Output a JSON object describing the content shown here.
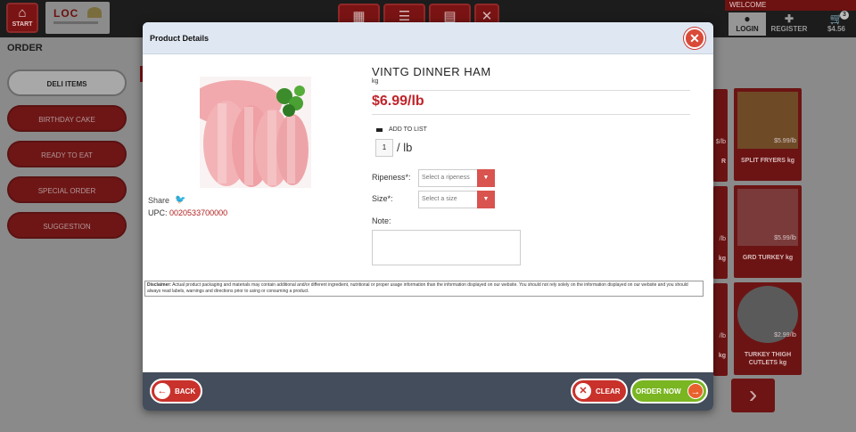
{
  "app": {
    "start_label": "START",
    "logo_text": "LOC",
    "welcome": "WELCOME",
    "login": "LOGIN",
    "register": "REGISTER",
    "cart_total": "$4.56",
    "cart_count": "3",
    "nav_icons": [
      "grid-view-icon",
      "list-view-icon",
      "flyer-icon",
      "recipes-icon"
    ]
  },
  "order": {
    "title": "ORDER",
    "categories": [
      {
        "label": "DELI ITEMS",
        "selected": true
      },
      {
        "label": "BIRTHDAY CAKE",
        "selected": false
      },
      {
        "label": "READY TO EAT",
        "selected": false
      },
      {
        "label": "SPECIAL ORDER",
        "selected": false
      },
      {
        "label": "SUGGESTION",
        "selected": false
      }
    ],
    "products": [
      {
        "name": "SPLIT FRYERS kg",
        "price": "$5.99/lb"
      },
      {
        "name": "GRD TURKEY kg",
        "price": "$5.99/lb"
      },
      {
        "name": "TURKEY THIGH CUTLETS kg",
        "price": "$2.99/lb"
      }
    ],
    "partial_cards": [
      {
        "name": "R",
        "price": "$/lb"
      },
      {
        "name": "kg",
        "price": "/lb"
      },
      {
        "name": "kg",
        "price": "/lb"
      }
    ]
  },
  "modal": {
    "title": "Product Details",
    "product_name": "VINTG DINNER HAM",
    "unit": "kg",
    "price": "$6.99/lb",
    "add_to_list": "ADD TO LIST",
    "quantity": "1",
    "quantity_unit": "/ lb",
    "share_label": "Share",
    "upc_label": "UPC:",
    "upc": "0020533700000",
    "ripeness_label": "Ripeness*:",
    "ripeness_placeholder": "Select a ripeness",
    "size_label": "Size*:",
    "size_placeholder": "Select a size",
    "note_label": "Note:",
    "disclaimer_title": "Disclaimer:",
    "disclaimer_text": "Actual product packaging and materials may contain additional and/or different ingredient, nutritional or proper usage information than the information displayed on our website. You should not rely solely on the information displayed on our website and you should always read labels, warnings and directions prior to using or consuming a product.",
    "back": "BACK",
    "clear": "CLEAR",
    "order_now": "ORDER NOW"
  }
}
